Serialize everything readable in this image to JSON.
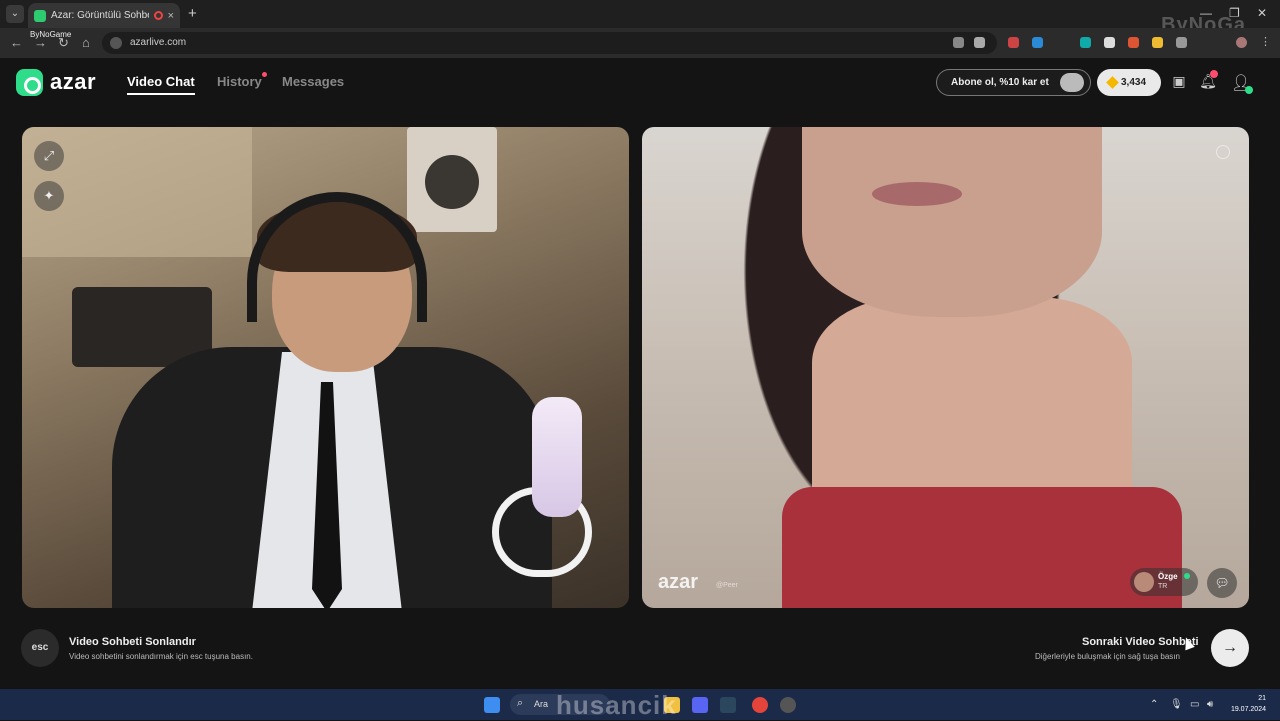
{
  "browser": {
    "tab_title": "Azar: Görüntülü Sohbet &",
    "tab_close": "×",
    "new_tab": "+",
    "tab_list": "⌄",
    "url": "azarlive.com",
    "overlay_label": "ByNoGame",
    "corner_watermark": "ByNoGa"
  },
  "header": {
    "logo": "azar",
    "nav": {
      "video_chat": "Video Chat",
      "history": "History",
      "messages": "Messages"
    },
    "subscribe": "Abone ol, %10 kar et",
    "coins": "3,434",
    "notifications_count": "1"
  },
  "peer": {
    "name": "Özge",
    "country": "TR",
    "watermark": "azar",
    "watermark_sub": "@Peer"
  },
  "bottom": {
    "esc_key": "esc",
    "end_title": "Video Sohbeti Sonlandır",
    "end_sub": "Video sohbetini sonlandırmak için esc tuşuna basın.",
    "next_title": "Sonraki Video Sohbeti",
    "next_sub": "Diğerleriyle buluşmak için sağ tuşa basın"
  },
  "taskbar": {
    "search": "Ara",
    "watermark": "husancik",
    "clock_time": "21",
    "clock_date": "19.07.2024"
  },
  "colors": {
    "brand": "#2edc8a",
    "background": "#141414",
    "notification_dot": "#ff4d6d"
  },
  "icons": {
    "expand": "expand-icon",
    "effects": "magic-wand-icon",
    "chat": "chat-bubble-icon",
    "next": "arrow-right-icon",
    "store": "store-icon",
    "bell": "bell-icon",
    "profile": "profile-icon"
  }
}
